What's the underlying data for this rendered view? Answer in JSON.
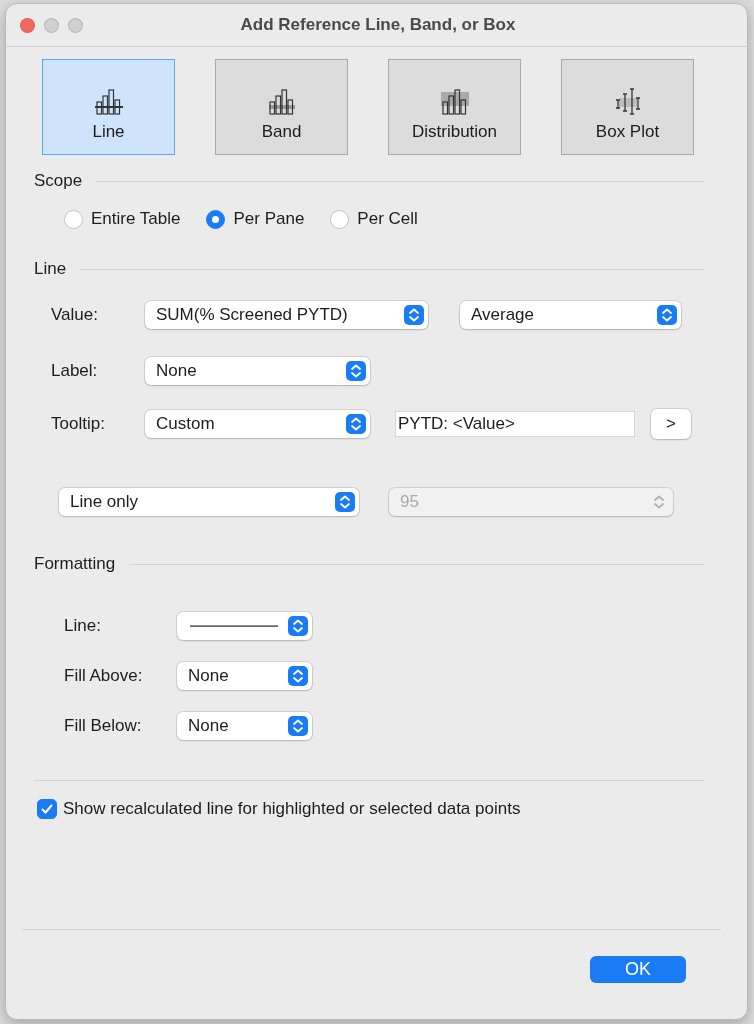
{
  "window": {
    "title": "Add Reference Line, Band, or Box"
  },
  "types": [
    {
      "kind": "line",
      "label": "Line",
      "selected": true
    },
    {
      "kind": "band",
      "label": "Band",
      "selected": false
    },
    {
      "kind": "distribution",
      "label": "Distribution",
      "selected": false
    },
    {
      "kind": "boxplot",
      "label": "Box Plot",
      "selected": false
    }
  ],
  "scope": {
    "heading": "Scope",
    "options": [
      {
        "label": "Entire Table",
        "selected": false
      },
      {
        "label": "Per Pane",
        "selected": true
      },
      {
        "label": "Per Cell",
        "selected": false
      }
    ]
  },
  "line": {
    "heading": "Line",
    "value": {
      "label": "Value:",
      "field": "SUM(% Screened PYTD)",
      "aggregation": "Average"
    },
    "label": {
      "label": "Label:",
      "value": "None"
    },
    "tooltip": {
      "label": "Tooltip:",
      "value": "Custom",
      "text": "PYTD: <Value>",
      "button": ">"
    },
    "display": {
      "value": "Line only"
    },
    "percentile": {
      "value": "95",
      "disabled": true
    }
  },
  "formatting": {
    "heading": "Formatting",
    "line": {
      "label": "Line:"
    },
    "fill_above": {
      "label": "Fill Above:",
      "value": "None"
    },
    "fill_below": {
      "label": "Fill Below:",
      "value": "None"
    }
  },
  "recalculate": {
    "label": "Show recalculated line for highlighted or selected data points",
    "checked": true
  },
  "ok_button": "OK"
}
